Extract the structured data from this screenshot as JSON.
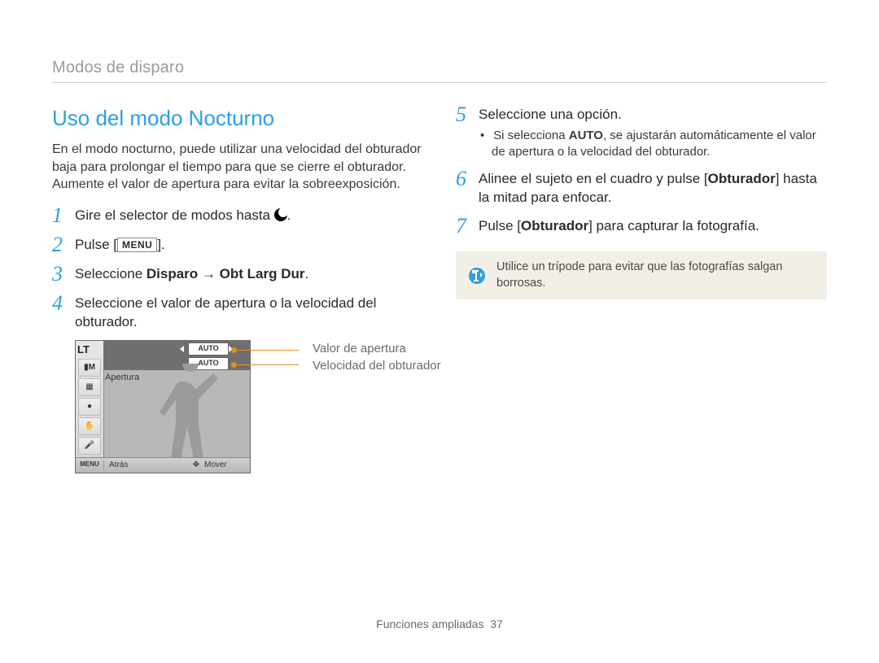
{
  "breadcrumb": "Modos de disparo",
  "section_title": "Uso del modo Nocturno",
  "intro": "En el modo nocturno, puede utilizar una velocidad del obturador baja para prolongar el tiempo para que se cierre el obturador. Aumente el valor de apertura para evitar la sobreexposición.",
  "steps_left": {
    "1": {
      "num": "1",
      "prefix": "Gire el selector de modos hasta ",
      "suffix": "."
    },
    "2": {
      "num": "2",
      "prefix": "Pulse [",
      "key": "MENU",
      "suffix": "]."
    },
    "3": {
      "num": "3",
      "prefix": "Seleccione ",
      "bold1": "Disparo",
      "arrow": " → ",
      "bold2": "Obt Larg Dur",
      "suffix": "."
    },
    "4": {
      "num": "4",
      "text": "Seleccione el valor de apertura o la velocidad del obturador."
    }
  },
  "lcd": {
    "lt": "LT",
    "icon_mode": "M",
    "pill_auto1": "AUTO",
    "pill_auto2": "AUTO",
    "aperture_label": "Apertura",
    "bottom_menu": "MENU",
    "bottom_back": "Atrás",
    "bottom_move": "Mover"
  },
  "callouts": {
    "aperture": "Valor de apertura",
    "shutter": "Velocidad del obturador"
  },
  "steps_right": {
    "5": {
      "num": "5",
      "text": "Seleccione una opción.",
      "bullet_pre": "Si selecciona ",
      "bullet_bold": "AUTO",
      "bullet_post": ", se ajustarán automáticamente el valor de apertura o la velocidad del obturador."
    },
    "6": {
      "num": "6",
      "pre": "Alinee el sujeto en el cuadro y pulse [",
      "bold": "Obturador",
      "post": "] hasta la mitad para enfocar."
    },
    "7": {
      "num": "7",
      "pre": "Pulse [",
      "bold": "Obturador",
      "post": "] para capturar la fotografía."
    }
  },
  "note": "Utilice un trípode para evitar que las fotografías salgan borrosas.",
  "footer_label": "Funciones ampliadas",
  "footer_page": "37"
}
